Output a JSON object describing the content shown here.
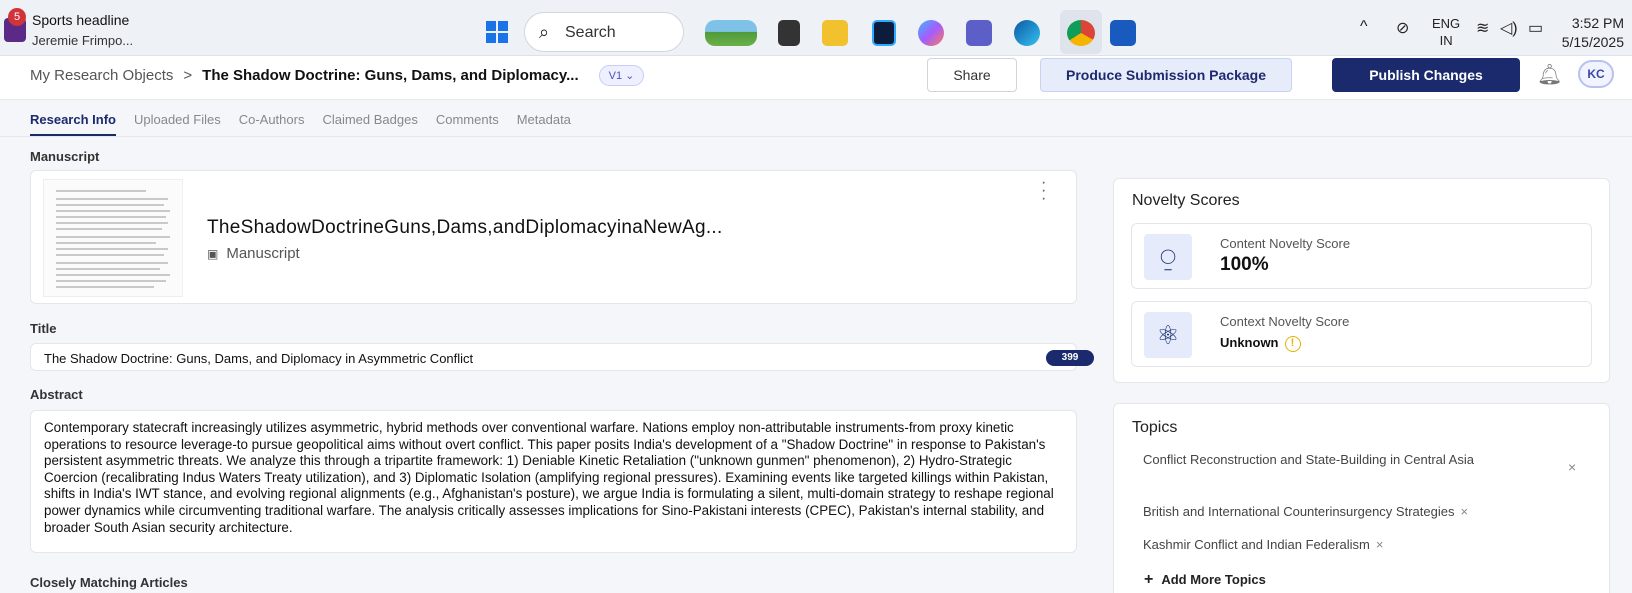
{
  "taskbar": {
    "notification": {
      "badge": "5",
      "title": "Sports headline",
      "subtitle": "Jeremie Frimpo..."
    },
    "search_label": "Search",
    "tray": {
      "lang_line1": "ENG",
      "lang_line2": "IN",
      "time": "3:52 PM",
      "date": "5/15/2025"
    },
    "app_icons": [
      "landscape-icon",
      "file-explorer-icon",
      "folder-icon",
      "photoshop-icon",
      "copilot-icon",
      "teams-icon",
      "edge-icon",
      "chrome-icon",
      "word-icon"
    ]
  },
  "header": {
    "breadcrumb_root": "My Research Objects",
    "breadcrumb_sep": ">",
    "breadcrumb_current": "The Shadow Doctrine: Guns, Dams, and Diplomacy...",
    "version": "V1 ⌄",
    "share_label": "Share",
    "produce_label": "Produce Submission Package",
    "publish_label": "Publish Changes",
    "avatar_initials": "KC"
  },
  "tabs": [
    {
      "label": "Research Info",
      "active": true
    },
    {
      "label": "Uploaded Files",
      "active": false
    },
    {
      "label": "Co-Authors",
      "active": false
    },
    {
      "label": "Claimed Badges",
      "active": false
    },
    {
      "label": "Comments",
      "active": false
    },
    {
      "label": "Metadata",
      "active": false
    }
  ],
  "manuscript": {
    "section_label": "Manuscript",
    "file_name": "TheShadowDoctrineGuns,Dams,andDiplomacyinaNewAg...",
    "file_type": "Manuscript"
  },
  "title_field": {
    "section_label": "Title",
    "value": "The Shadow Doctrine: Guns, Dams, and Diplomacy in Asymmetric Conflict",
    "char_count": "399"
  },
  "abstract": {
    "section_label": "Abstract",
    "text": "Contemporary statecraft increasingly utilizes asymmetric, hybrid methods over conventional warfare. Nations employ non-attributable instruments-from proxy kinetic operations to resource leverage-to pursue geopolitical aims without overt conflict. This paper posits India's development of a \"Shadow Doctrine\" in response to Pakistan's persistent asymmetric threats. We analyze this through a tripartite framework: 1) Deniable Kinetic Retaliation (\"unknown gunmen\" phenomenon), 2) Hydro-Strategic Coercion (recalibrating Indus Waters Treaty utilization), and 3) Diplomatic Isolation (amplifying regional pressures). Examining events like targeted killings within Pakistan, shifts in India's IWT stance, and evolving regional alignments (e.g., Afghanistan's posture), we argue India is formulating a silent, multi-domain strategy to reshape regional power dynamics while circumventing traditional warfare. The analysis critically assesses implications for Sino-Pakistani interests (CPEC), Pakistan's internal stability, and broader South Asian security architecture."
  },
  "closely_matching": {
    "section_label": "Closely Matching Articles"
  },
  "novelty": {
    "heading": "Novelty Scores",
    "content_label": "Content Novelty Score",
    "content_value": "100%",
    "context_label": "Context Novelty Score",
    "context_value": "Unknown",
    "warn_glyph": "!"
  },
  "topics": {
    "heading": "Topics",
    "items": [
      "Conflict Reconstruction and State-Building in Central Asia",
      "British and International Counterinsurgency Strategies",
      "Kashmir Conflict and Indian Federalism"
    ],
    "add_label": "Add More Topics"
  }
}
